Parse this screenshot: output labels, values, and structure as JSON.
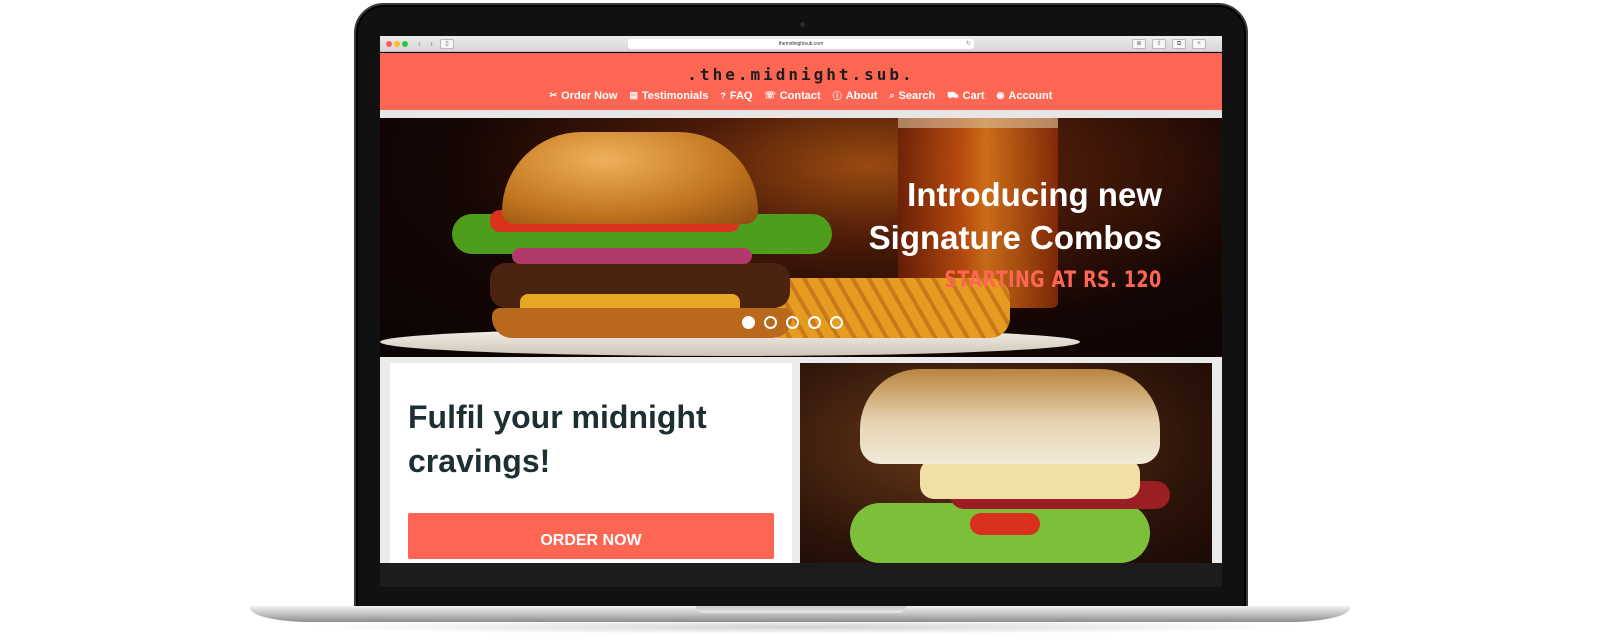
{
  "browser": {
    "url": "themidnightsub.com",
    "traffic_colors": [
      "#fe5f57",
      "#febc2e",
      "#28c840"
    ]
  },
  "site": {
    "brand": ".the.midnight.sub.",
    "brand_color": "#fe6654",
    "nav": [
      {
        "label": "Order Now",
        "icon": "utensils-icon",
        "glyph": "✂"
      },
      {
        "label": "Testimonials",
        "icon": "document-icon",
        "glyph": "▤"
      },
      {
        "label": "FAQ",
        "icon": "question-icon",
        "glyph": "?"
      },
      {
        "label": "Contact",
        "icon": "contact-card-icon",
        "glyph": "☏"
      },
      {
        "label": "About",
        "icon": "info-icon",
        "glyph": "ⓘ"
      },
      {
        "label": "Search",
        "icon": "search-icon",
        "glyph": "⌕"
      },
      {
        "label": "Cart",
        "icon": "cart-icon",
        "glyph": "⛟"
      },
      {
        "label": "Account",
        "icon": "user-icon",
        "glyph": "◉"
      }
    ]
  },
  "hero": {
    "title": "Introducing new Signature Combos",
    "subtitle": "STARTING AT RS. 120",
    "carousel_slides": 5,
    "active_slide": 1
  },
  "promo": {
    "heading": "Fulfil your midnight cravings!",
    "button_label": "ORDER NOW"
  }
}
